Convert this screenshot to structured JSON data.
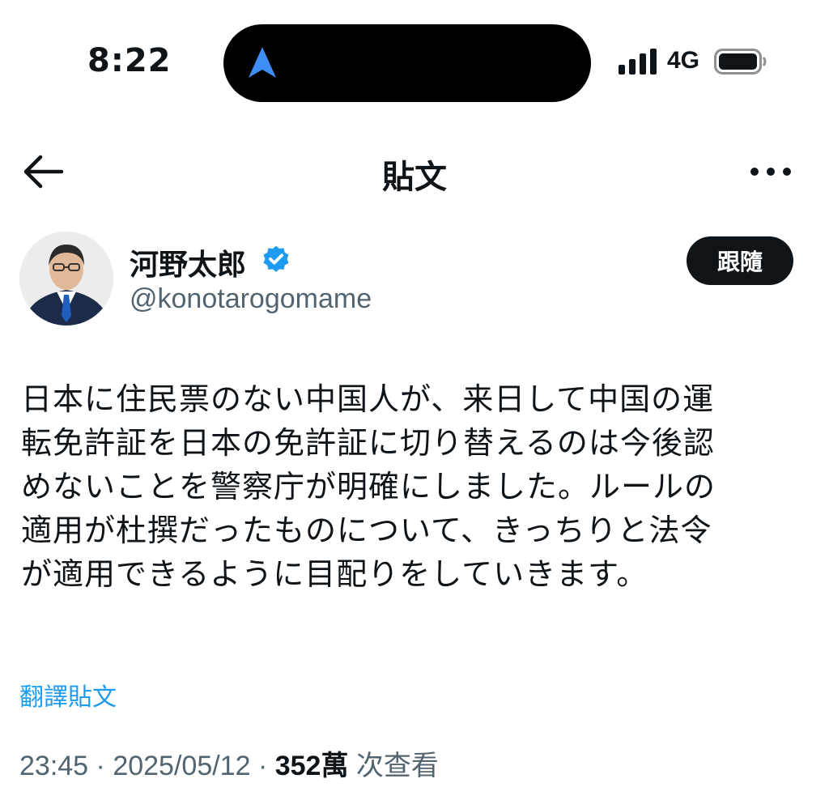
{
  "status_bar": {
    "time": "8:22",
    "network": "4G"
  },
  "header": {
    "title": "貼文"
  },
  "author": {
    "name": "河野太郎",
    "handle": "@konotarogomame",
    "follow_label": "跟隨"
  },
  "tweet": {
    "text": "日本に住民票のない中国人が、来日して中国の運\n転免許証を日本の免許証に切り替えるのは今後認\nめないことを警察庁が明確にしました。ルールの\n適用が杜撰だったものについて、きっちりと法令\nが適用できるように目配りをしていきます。",
    "translate_label": "翻譯貼文",
    "time": "23:45",
    "separator": "·",
    "date": "2025/05/12",
    "views_count": "352萬",
    "views_label": "次查看"
  },
  "colors": {
    "accent": "#1d9bf0",
    "text_primary": "#0f1419",
    "text_secondary": "#536471",
    "verified_badge": "#1d9bf0",
    "nav_arrow": "#3e8ef7"
  },
  "icons": {
    "back": "arrow-left-icon",
    "more": "more-horizontal-icon",
    "verified": "verified-badge-icon",
    "navigation": "location-arrow-icon",
    "signal": "cellular-signal-icon",
    "battery": "battery-icon"
  }
}
